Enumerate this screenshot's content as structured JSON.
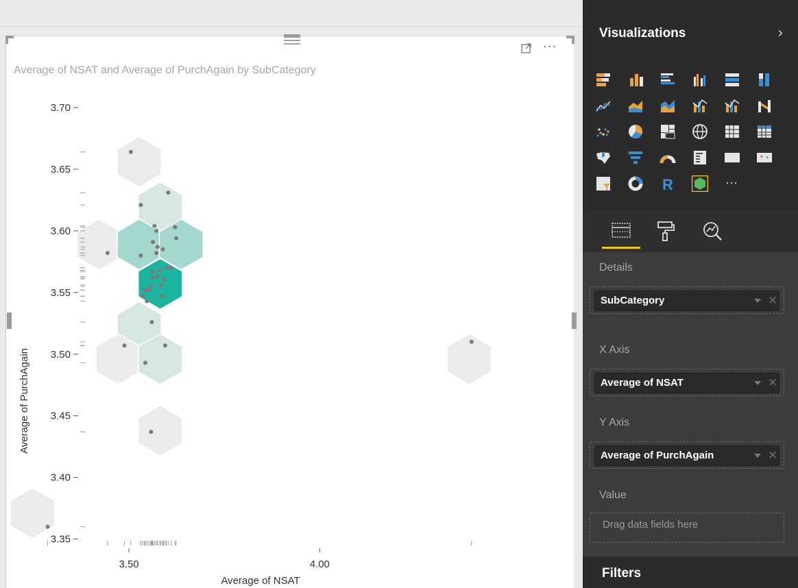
{
  "visual": {
    "title": "Average of NSAT and Average of PurchAgain by SubCategory",
    "focus_icon": "focus-mode-icon",
    "more_label": "···"
  },
  "chart_data": {
    "type": "scatter",
    "subtype": "hexbin",
    "title": "Average of NSAT and Average of PurchAgain by SubCategory",
    "xlabel": "Average of NSAT",
    "ylabel": "Average of PurchAgain",
    "xticks": [
      "3.50",
      "4.00"
    ],
    "yticks": [
      "3.70",
      "3.65",
      "3.60",
      "3.55",
      "3.50",
      "3.45",
      "3.40",
      "3.35"
    ],
    "xlim": [
      3.18,
      4.42
    ],
    "ylim": [
      3.347,
      3.715
    ],
    "colors": {
      "hex_empty": "#ebebeb",
      "hex_low": "#d6e6e2",
      "hex_mid": "#a4d7cd",
      "hex_high": "#1bb49f",
      "point": "#7a7a7a"
    },
    "hexes": [
      {
        "x": 3.527,
        "y": 3.656,
        "level": 0
      },
      {
        "x": 3.582,
        "y": 3.619,
        "level": 1
      },
      {
        "x": 3.422,
        "y": 3.589,
        "level": 0
      },
      {
        "x": 3.527,
        "y": 3.589,
        "level": 2
      },
      {
        "x": 3.637,
        "y": 3.589,
        "level": 2
      },
      {
        "x": 3.582,
        "y": 3.557,
        "level": 3
      },
      {
        "x": 3.527,
        "y": 3.522,
        "level": 1
      },
      {
        "x": 3.472,
        "y": 3.496,
        "level": 0
      },
      {
        "x": 3.582,
        "y": 3.496,
        "level": 1
      },
      {
        "x": 3.582,
        "y": 3.438,
        "level": 0
      },
      {
        "x": 3.247,
        "y": 3.371,
        "level": 0
      },
      {
        "x": 4.392,
        "y": 3.496,
        "level": 0
      }
    ],
    "points": [
      {
        "x": 3.505,
        "y": 3.664
      },
      {
        "x": 3.531,
        "y": 3.621
      },
      {
        "x": 3.603,
        "y": 3.631
      },
      {
        "x": 3.567,
        "y": 3.604
      },
      {
        "x": 3.572,
        "y": 3.6
      },
      {
        "x": 3.621,
        "y": 3.603
      },
      {
        "x": 3.563,
        "y": 3.591
      },
      {
        "x": 3.575,
        "y": 3.587
      },
      {
        "x": 3.624,
        "y": 3.594
      },
      {
        "x": 3.572,
        "y": 3.582
      },
      {
        "x": 3.589,
        "y": 3.585
      },
      {
        "x": 3.531,
        "y": 3.58
      },
      {
        "x": 3.444,
        "y": 3.582
      },
      {
        "x": 3.562,
        "y": 3.567
      },
      {
        "x": 3.581,
        "y": 3.568
      },
      {
        "x": 3.598,
        "y": 3.57
      },
      {
        "x": 3.611,
        "y": 3.57
      },
      {
        "x": 3.562,
        "y": 3.562
      },
      {
        "x": 3.575,
        "y": 3.563
      },
      {
        "x": 3.591,
        "y": 3.561
      },
      {
        "x": 3.556,
        "y": 3.555
      },
      {
        "x": 3.583,
        "y": 3.556
      },
      {
        "x": 3.541,
        "y": 3.552
      },
      {
        "x": 3.551,
        "y": 3.552
      },
      {
        "x": 3.536,
        "y": 3.547
      },
      {
        "x": 3.588,
        "y": 3.547
      },
      {
        "x": 3.547,
        "y": 3.543
      },
      {
        "x": 3.56,
        "y": 3.526
      },
      {
        "x": 3.488,
        "y": 3.507
      },
      {
        "x": 3.595,
        "y": 3.507
      },
      {
        "x": 3.543,
        "y": 3.493
      },
      {
        "x": 3.558,
        "y": 3.437
      },
      {
        "x": 3.287,
        "y": 3.36
      },
      {
        "x": 4.398,
        "y": 3.51
      }
    ]
  },
  "pane": {
    "title": "Visualizations",
    "chevron": "›",
    "gallery_icons": [
      "stacked-bar-chart-icon",
      "stacked-column-chart-icon",
      "clustered-bar-chart-icon",
      "clustered-column-chart-icon",
      "100-stacked-bar-chart-icon",
      "100-stacked-column-chart-icon",
      "line-chart-icon",
      "area-chart-icon",
      "stacked-area-chart-icon",
      "line-and-stacked-column-chart-icon",
      "line-and-clustered-column-chart-icon",
      "ribbon-chart-icon",
      "scatter-chart-icon",
      "pie-chart-icon",
      "treemap-icon",
      "globe-map-icon",
      "table-icon",
      "matrix-icon",
      "filled-map-icon",
      "funnel-icon",
      "gauge-icon",
      "multi-row-card-icon",
      "card-icon",
      "kpi-icon",
      "slicer-icon",
      "donut-chart-icon",
      "r-visual-icon",
      "hexbin-visual-icon",
      "more-visuals-icon"
    ],
    "r_label": "R",
    "more_label": "···",
    "tabs": [
      "fields-tab-icon",
      "format-tab-icon",
      "analytics-tab-icon"
    ],
    "wells": {
      "details": {
        "label": "Details",
        "field": "SubCategory"
      },
      "x_axis": {
        "label": "X Axis",
        "field": "Average of NSAT"
      },
      "y_axis": {
        "label": "Y Axis",
        "field": "Average of PurchAgain"
      },
      "value": {
        "label": "Value",
        "placeholder": "Drag data fields here"
      }
    },
    "remove_label": "×",
    "filters_title": "Filters"
  }
}
